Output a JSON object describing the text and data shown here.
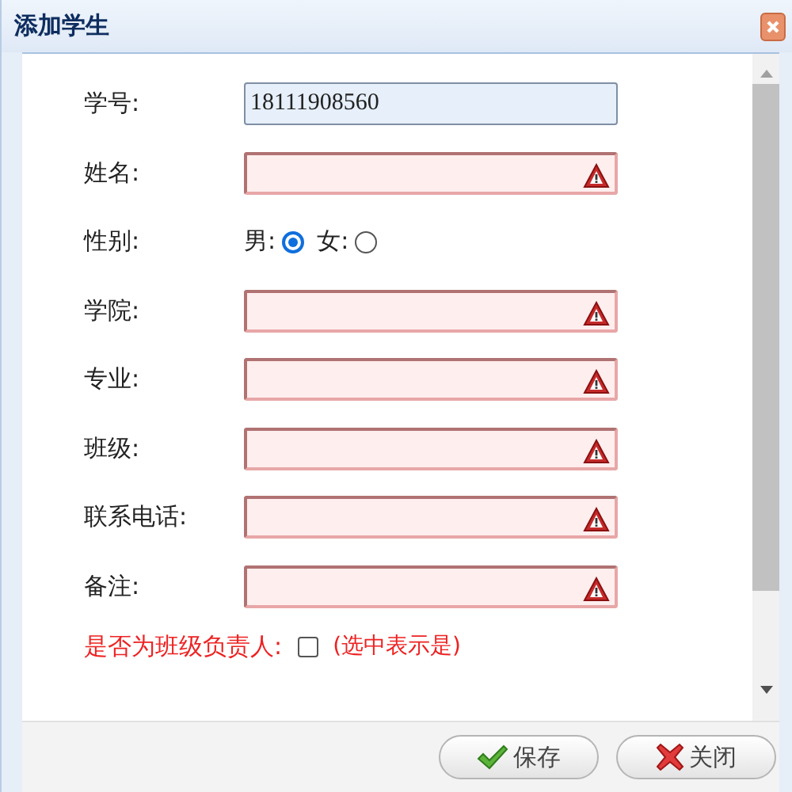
{
  "window": {
    "title": "添加学生"
  },
  "fields": [
    {
      "kind": "text",
      "label": "学号:",
      "value": "18111908560",
      "invalid": false
    },
    {
      "kind": "text",
      "label": "姓名:",
      "invalid": true
    },
    {
      "kind": "radio",
      "label": "性别:",
      "options": [
        {
          "label": "男:",
          "selected": true
        },
        {
          "label": "女:",
          "selected": false
        }
      ]
    },
    {
      "kind": "text",
      "label": "学院:",
      "invalid": true
    },
    {
      "kind": "text",
      "label": "专业:",
      "invalid": true
    },
    {
      "kind": "text",
      "label": "班级:",
      "invalid": true
    },
    {
      "kind": "text",
      "label": "联系电话:",
      "invalid": true
    },
    {
      "kind": "text",
      "label": "备注:",
      "invalid": true
    }
  ],
  "class_leader": {
    "label": "是否为班级负责人:",
    "checked": false,
    "hint": "(选中表示是)"
  },
  "buttons": [
    {
      "kind": "save",
      "label": "保存"
    },
    {
      "kind": "close",
      "label": "关闭"
    }
  ]
}
